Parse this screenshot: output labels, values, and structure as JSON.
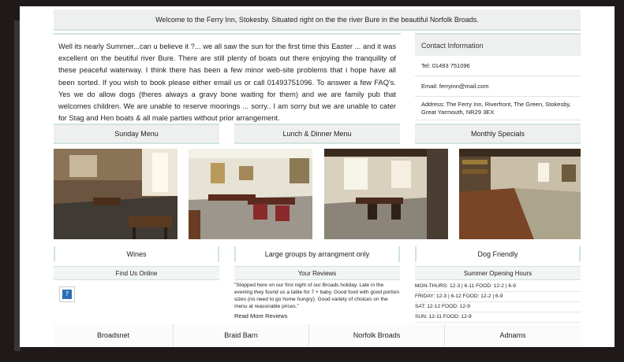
{
  "welcome": "Welcome to the Ferry Inn, Stokesby. Situated right on the the river Bure in the beautiful Norfolk Broads.",
  "intro": "Well its nearly Summer...can u believe it ?... we all saw the sun for the first time this Easter ... and it was excellent on the beutiful river Bure. There are still plenty of boats out there enjoying the tranquility of these peaceful waterway. I think there has been a few minor web-site problems that i hope have all been sorted. If you wish to book please either email us or call 01493751096. To answer a few FAQ's. Yes we do allow dogs (theres always a gravy bone waiting for them) and we are family pub that welcomes children. We are unable to reserve moorings ... sorry.. I am sorry but we are unable to cater for Stag and Hen boats & all male parties without prior arrangement.",
  "contact": {
    "heading": "Contact Information",
    "tel": "Tel: 01493 751096",
    "email": "Email: ferryinn@mail.com",
    "address": "Address: The Ferry Inn, Riverfront, The Green, Stokesby, Great Yarmouth, NR29 3EX"
  },
  "menus": [
    "Sunday Menu",
    "Lunch & Dinner Menu",
    "Monthly Specials"
  ],
  "labels": [
    "Wines",
    "Large groups by arrangment only",
    "Dog Friendly"
  ],
  "sections": {
    "find_us": "Find Us Online",
    "reviews": "Your Reviews",
    "hours": "Summer Opening Hours"
  },
  "review_text": "\"Stopped here on our first night of our Broads holiday. Late in the evening they found us a table for 7 + baby. Good food with good portion sizes (no need to go home hungry). Good variety of choices on the menu at reasonable prices.\"",
  "read_more": "Read More Reviews",
  "hours": [
    "MON-THURS: 12-3 | 6-11 FOOD: 12-2 | 6-9",
    "FRIDAY: 12-3 | 6-12 FOOD: 12-2 | 6-9",
    "SAT: 12-12 FOOD: 12-9",
    "SUN: 12-11 FOOD: 12-9"
  ],
  "footer": [
    "Broadsnet",
    "Braid Barn",
    "Norfolk Broads",
    "Adnams"
  ],
  "colors": {
    "accent_border": "#cfe3e3",
    "panel_gray": "#eef0ef",
    "background": "#1f1a19"
  },
  "icons": {
    "find_us": "question-mark-icon"
  }
}
